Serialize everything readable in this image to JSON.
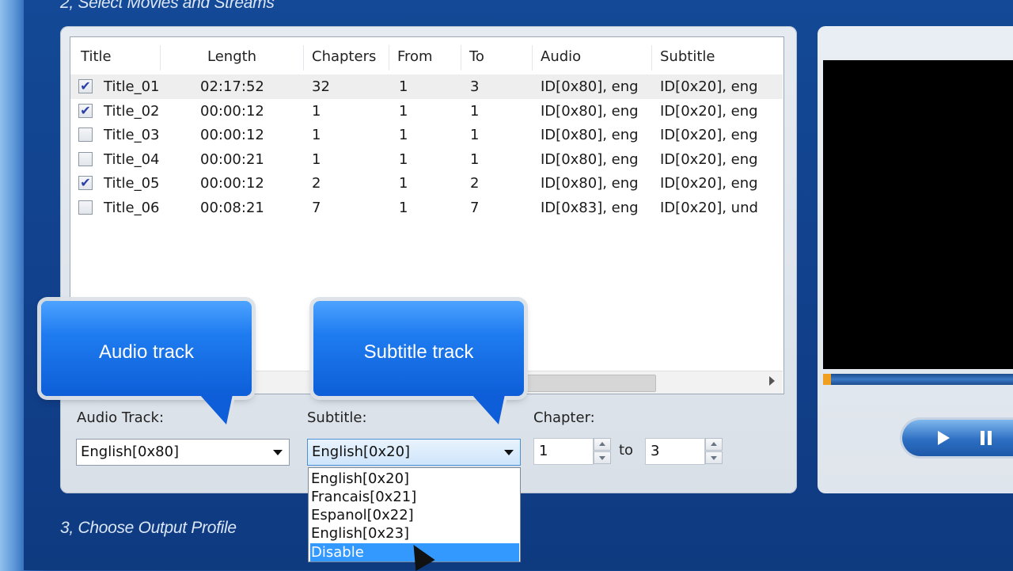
{
  "sections": {
    "select_heading": "2, Select Movies and Streams",
    "output_heading": "3, Choose Output Profile"
  },
  "table": {
    "columns": [
      "Title",
      "Length",
      "Chapters",
      "From",
      "To",
      "Audio",
      "Subtitle"
    ],
    "rows": [
      {
        "checked": true,
        "title": "Title_01",
        "length": "02:17:52",
        "chapters": "32",
        "from": "1",
        "to": "3",
        "audio": "ID[0x80], eng",
        "subtitle": "ID[0x20], eng"
      },
      {
        "checked": true,
        "title": "Title_02",
        "length": "00:00:12",
        "chapters": "1",
        "from": "1",
        "to": "1",
        "audio": "ID[0x80], eng",
        "subtitle": "ID[0x20], eng"
      },
      {
        "checked": false,
        "title": "Title_03",
        "length": "00:00:12",
        "chapters": "1",
        "from": "1",
        "to": "1",
        "audio": "ID[0x80], eng",
        "subtitle": "ID[0x20], eng"
      },
      {
        "checked": false,
        "title": "Title_04",
        "length": "00:00:21",
        "chapters": "1",
        "from": "1",
        "to": "1",
        "audio": "ID[0x80], eng",
        "subtitle": "ID[0x20], eng"
      },
      {
        "checked": true,
        "title": "Title_05",
        "length": "00:00:12",
        "chapters": "2",
        "from": "1",
        "to": "2",
        "audio": "ID[0x80], eng",
        "subtitle": "ID[0x20], eng"
      },
      {
        "checked": false,
        "title": "Title_06",
        "length": "00:08:21",
        "chapters": "7",
        "from": "1",
        "to": "7",
        "audio": "ID[0x83], eng",
        "subtitle": "ID[0x20], und"
      }
    ]
  },
  "callouts": {
    "audio": "Audio track",
    "subtitle": "Subtitle track"
  },
  "controls": {
    "audio_label": "Audio Track:",
    "audio_value": "English[0x80]",
    "subtitle_label": "Subtitle:",
    "subtitle_value": "English[0x20]",
    "chapter_label": "Chapter:",
    "chapter_from": "1",
    "chapter_to_label": "to",
    "chapter_to": "3"
  },
  "subtitle_dropdown": {
    "options": [
      "English[0x20]",
      "Francais[0x21]",
      "Espanol[0x22]",
      "English[0x23]",
      "Disable"
    ],
    "highlighted": "Disable"
  },
  "icons": {
    "checkmark": "✔"
  }
}
